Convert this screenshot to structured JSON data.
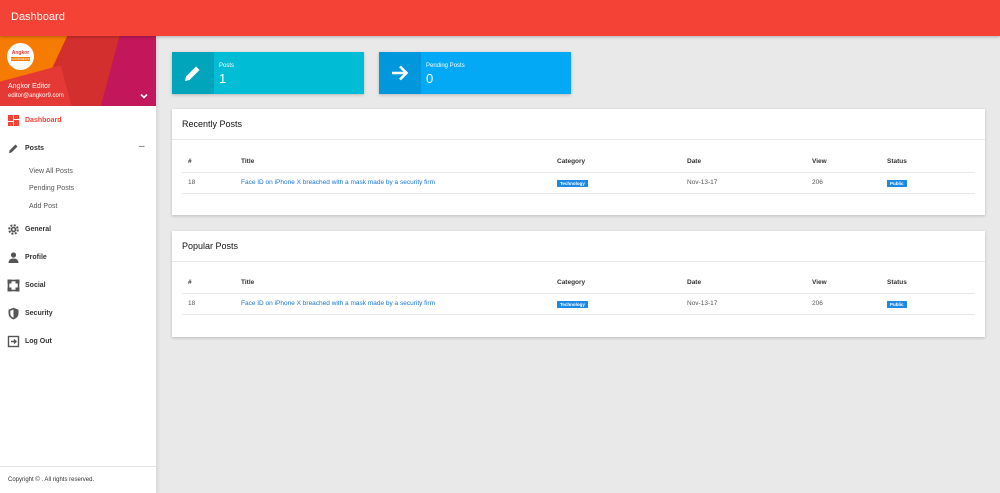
{
  "app": {
    "title": "Dashboard"
  },
  "user": {
    "name": "Angkor Editor",
    "email": "editor@angkor9.com",
    "logo_line1": "Angkor",
    "logo_line2": "GOODNEWS"
  },
  "sidebar": {
    "items": [
      {
        "key": "dashboard",
        "label": "Dashboard",
        "icon": "dashboard-icon",
        "active": true
      },
      {
        "key": "posts",
        "label": "Posts",
        "icon": "pencil-icon",
        "toggle": "–",
        "children": [
          {
            "label": "View All Posts"
          },
          {
            "label": "Pending Posts"
          },
          {
            "label": "Add Post"
          }
        ]
      },
      {
        "key": "general",
        "label": "General",
        "icon": "gear-icon"
      },
      {
        "key": "profile",
        "label": "Profile",
        "icon": "person-icon"
      },
      {
        "key": "social",
        "label": "Social",
        "icon": "social-icon"
      },
      {
        "key": "security",
        "label": "Security",
        "icon": "shield-icon"
      },
      {
        "key": "logout",
        "label": "Log Out",
        "icon": "logout-icon"
      }
    ],
    "copyright": "Copyright © . All rights reserved."
  },
  "stats": [
    {
      "label": "Posts",
      "value": "1",
      "icon": "pencil-icon",
      "color": "#00bcd4",
      "icon_bg": "#00a5bb"
    },
    {
      "label": "Pending Posts",
      "value": "0",
      "icon": "arrow-right-icon",
      "color": "#03a9f4",
      "icon_bg": "#0097dd"
    }
  ],
  "recent": {
    "title": "Recently Posts",
    "columns": [
      "#",
      "Title",
      "Category",
      "Date",
      "View",
      "Status"
    ],
    "rows": [
      {
        "id": "18",
        "title": "Face ID on iPhone X breached with a mask made by a security firm",
        "category": "Technology",
        "date": "Nov-13-17",
        "view": "206",
        "status": "Public"
      }
    ]
  },
  "popular": {
    "title": "Popular Posts",
    "columns": [
      "#",
      "Title",
      "Category",
      "Date",
      "View",
      "Status"
    ],
    "rows": [
      {
        "id": "18",
        "title": "Face ID on iPhone X breached with a mask made by a security firm",
        "category": "Technology",
        "date": "Nov-13-17",
        "view": "206",
        "status": "Public"
      }
    ]
  },
  "colors": {
    "primary": "#f44336",
    "link": "#1976d2",
    "badge": "#1e88e5"
  }
}
